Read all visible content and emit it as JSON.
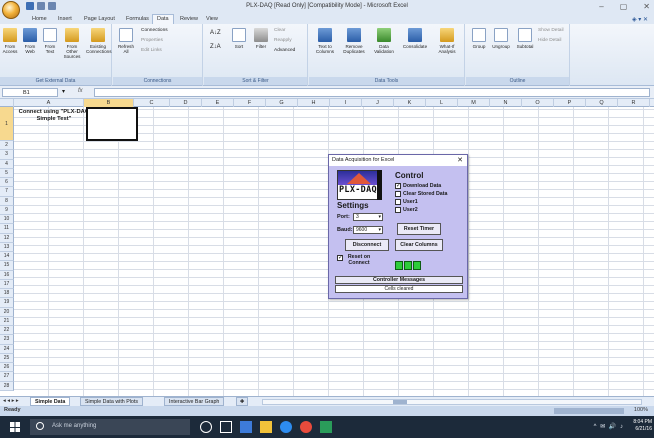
{
  "window": {
    "title": "PLX-DAQ [Read Only] [Compatibility Mode] - Microsoft Excel",
    "controls": [
      "–",
      "▢",
      "✕"
    ]
  },
  "tabs": [
    "Home",
    "Insert",
    "Page Layout",
    "Formulas",
    "Data",
    "Review",
    "View"
  ],
  "ribbon": {
    "external": {
      "group_label": "Get External Data",
      "buttons": [
        "From Access",
        "From Web",
        "From Text",
        "From Other Sources",
        "Existing Connections"
      ]
    },
    "connections": {
      "group_label": "Connections",
      "refresh": "Refresh All",
      "items": [
        "Connections",
        "Properties",
        "Edit Links"
      ]
    },
    "sort_filter": {
      "group_label": "Sort & Filter",
      "sort": "Sort",
      "filter": "Filter",
      "items": [
        "Clear",
        "Reapply",
        "Advanced"
      ]
    },
    "data_tools": {
      "group_label": "Data Tools",
      "buttons": [
        "Text to Columns",
        "Remove Duplicates",
        "Data Validation",
        "Consolidate",
        "What-If Analysis"
      ]
    },
    "outline": {
      "group_label": "Outline",
      "buttons": [
        "Group",
        "Ungroup",
        "Subtotal"
      ],
      "items": [
        "Show Detail",
        "Hide Detail"
      ]
    }
  },
  "formula_bar": {
    "name_box": "B1",
    "fx": "fx",
    "value": ""
  },
  "grid": {
    "columns": [
      "A",
      "B",
      "C",
      "D",
      "E",
      "F",
      "G",
      "H",
      "I",
      "J",
      "K",
      "L",
      "M",
      "N",
      "O",
      "P",
      "Q",
      "R",
      "S"
    ],
    "rows": [
      "1",
      "2",
      "3",
      "4",
      "5",
      "6",
      "7",
      "8",
      "9",
      "10",
      "11",
      "12",
      "13",
      "14",
      "15",
      "16",
      "17",
      "18",
      "19",
      "20",
      "21",
      "22",
      "23",
      "24",
      "25",
      "26",
      "27",
      "28"
    ],
    "selected_column": "B",
    "selected_row": "1",
    "cell_a1": "Connect using \"PLX-DAQ Simple Test\""
  },
  "dialog": {
    "title": "Data Acquisition for Excel",
    "close": "✕",
    "logo_text": "PLX-DAQ",
    "control_label": "Control",
    "checkboxes": [
      {
        "label": "Download Data",
        "checked": true
      },
      {
        "label": "Clear Stored Data",
        "checked": false
      },
      {
        "label": "User1",
        "checked": false
      },
      {
        "label": "User2",
        "checked": false
      }
    ],
    "settings_label": "Settings",
    "port_label": "Port:",
    "port_value": "3",
    "baud_label": "Baud:",
    "baud_value": "9600",
    "reset_timer": "Reset Timer",
    "disconnect": "Disconnect",
    "clear_columns": "Clear Columns",
    "reset_on_connect": "Reset on Connect",
    "reset_on_connect_checked": true,
    "controller_messages": "Controller Messages",
    "message": "Cells cleared"
  },
  "sheets": {
    "nav": "◂ ◂ ▸ ▸",
    "tabs": [
      "Simple Data",
      "Simple Data with Plots",
      "Interactive Bar Graph"
    ],
    "active": "Simple Data"
  },
  "status": {
    "text": "Ready",
    "zoom": "100%"
  },
  "taskbar": {
    "search_placeholder": "Ask me anything",
    "tray": "^ ✉ 🔊 ♪",
    "time": "8:04 PM",
    "date": "6/21/16"
  },
  "colors": {
    "ribbon": "#dfe8f4",
    "dialog_bg": "#c4c0f0",
    "led": "#2ecc3a",
    "taskbar": "#1c2a3a"
  }
}
